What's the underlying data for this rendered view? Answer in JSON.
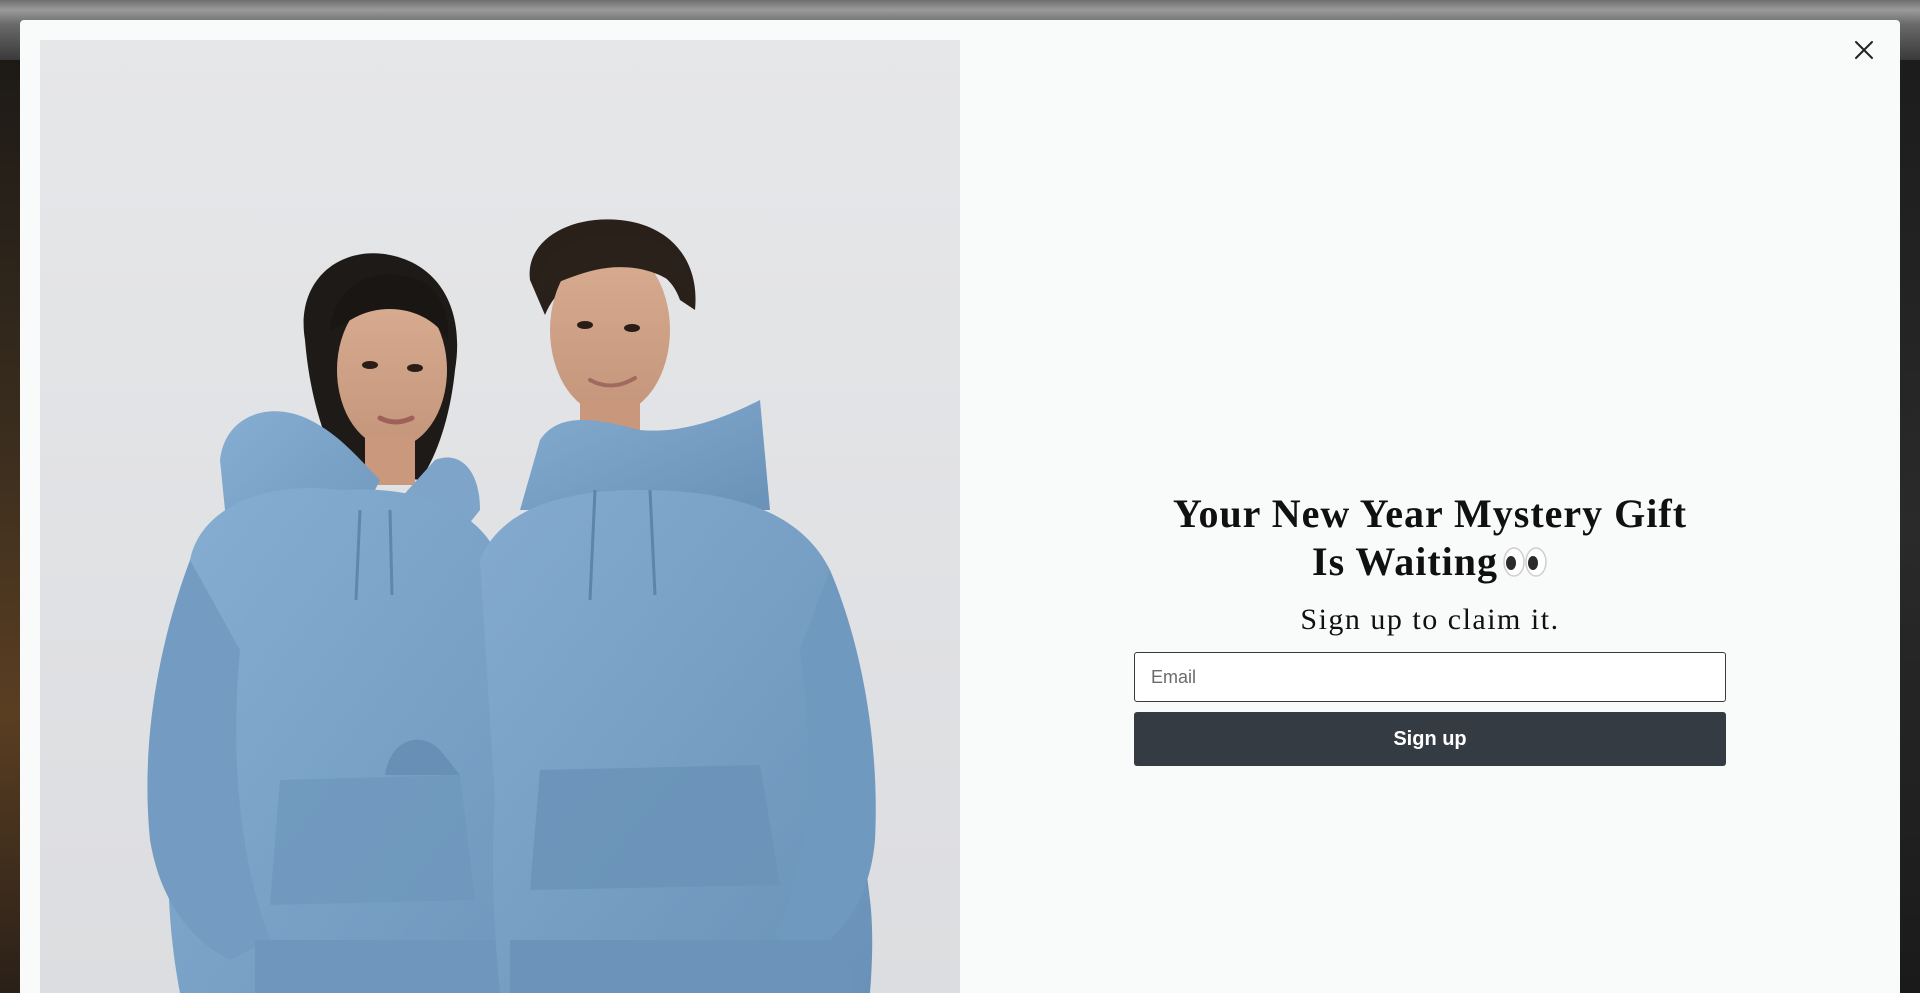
{
  "popup": {
    "close_label": "×",
    "close_icon": "close-icon",
    "headline_line1": "Your New Year Mystery Gift",
    "headline_line2": "Is Waiting",
    "headline_emoji": "eyes-icon",
    "subheadline": "Sign up to claim it.",
    "email_placeholder": "Email",
    "email_value": "",
    "signup_label": "Sign up",
    "image": {
      "alt": "Two models wearing matching light blue hoodies and sweatpants",
      "hoodie_color": "#7ea5c9"
    },
    "colors": {
      "button_bg": "#353b43",
      "modal_bg": "#f9fafa",
      "text": "#101010"
    }
  }
}
